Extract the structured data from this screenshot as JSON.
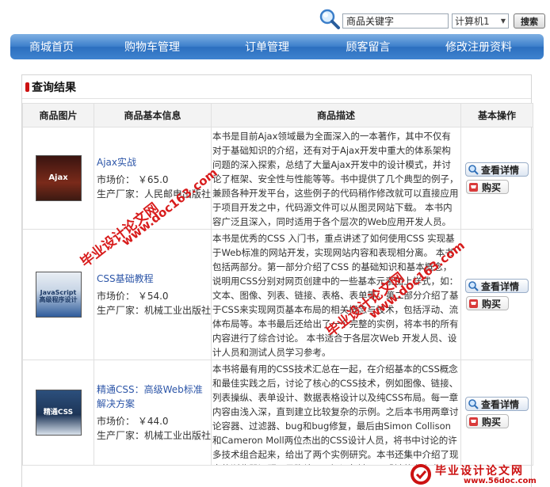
{
  "search": {
    "placeholder": "商品关键字",
    "category": "计算机1",
    "button": "搜索"
  },
  "nav": [
    "商城首页",
    "购物车管理",
    "订单管理",
    "顾客留言",
    "修改注册资料"
  ],
  "panel": {
    "title": "查询结果"
  },
  "table": {
    "headers": [
      "商品图片",
      "商品基本信息",
      "商品描述",
      "基本操作"
    ],
    "rows": [
      {
        "name": "Ajax实战",
        "price": "市场价： ￥65.0",
        "maker": "生产厂家：人民邮电出版社",
        "cover_text": "Ajax",
        "desc": "本书是目前Ajax领域最为全面深入的一本著作，其中不仅有对于基础知识的介绍，还有对于Ajax开发中重大的体系架构问题的深入探索，总结了大量Ajax开发中的设计模式，并讨论了框架、安全性与性能等等。书中提供了几个典型的例子，兼顾各种开发平台，这些例子的代码稍作修改就可以直接应用于项目开发之中，代码源文件可以从图灵网站下载。 本书内容广泛且深入，同时适用于各个层次的Web应用开发人员。",
        "detail_btn": "查看详情",
        "buy_btn": "购买"
      },
      {
        "name": "CSS基础教程",
        "price": "市场价： ￥54.0",
        "maker": "生产厂家：机械工业出版社",
        "cover_text": "JavaScript 高级程序设计",
        "desc": "本书是优秀的CSS 入门书，重点讲述了如何使用CSS 实现基于Web标准的网站开发，实现网站内容和表现相分离。 本书包括两部分。第一部分介绍了CSS 的基础知识和基本概念，说明用CSS分别对网页创建中的一些基本元素加上样式，如：文本、图像、列表、链接、表格、表单等。第二部分介绍了基于CSS来实现网页基本布局的相关概念与技术，包括浮动、流体布局等。本书最后还给出了一个完整的实例，将本书的所有内容进行了综合讨论。 本书适合于各层次Web 开发人员、设计人员和测试人员学习参考。",
        "detail_btn": "查看详情",
        "buy_btn": "购买"
      },
      {
        "name": "精通CSS：高级Web标准解决方案",
        "price": "市场价： ￥44.0",
        "maker": "生产厂家：机械工业出版社",
        "cover_text": "精通CSS",
        "desc": "本书将最有用的CSS技术汇总在一起，在介绍基本的CSS概念和最佳实践之后，讨论了核心的CSS技术，例如图像、链接、列表操纵、表单设计、数据表格设计以及纯CSS布局。每一章内容由浅入深，直到建立比较复杂的示例。之后本书用两章讨论容器、过滤器、bug和bug修复，最后由Simon Collison和Cameron Moll两位杰出的CSS设计人员，将书中讨论的许多技术组合起来，给出了两个实例研究。本书还集中介绍了现实的浏览器问题，是弥补CSS知识欠缺不可或缺的参考书。 本书适合具有(X)HTML和CSS",
        "detail_btn": "查看详情",
        "buy_btn": "购买"
      }
    ]
  },
  "watermarks": {
    "a": "毕业设计论文网",
    "b": "www.doc163.com"
  },
  "footer": {
    "title": "毕业设计论文网",
    "url": "www.56doc.com"
  }
}
